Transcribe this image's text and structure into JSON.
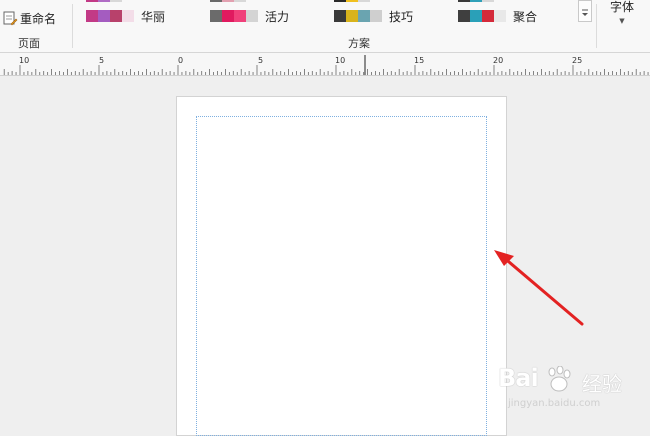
{
  "ribbon": {
    "page_group": {
      "rename_label": "重命名",
      "group_label": "页面"
    },
    "schemes_group": {
      "group_label": "方案",
      "top_row_swatches": [
        [
          "#c23a86",
          "#b06cc4",
          "#d8d8d8"
        ],
        [
          "#6a6a6a",
          "#e2a0b0",
          "#d8d8d8"
        ],
        [
          "#2a2a2a",
          "#f0c020",
          "#d8d8d8"
        ],
        [
          "#3a3a3a",
          "#30a0b8",
          "#d8d8d8"
        ]
      ],
      "schemes": [
        {
          "name": "华丽",
          "swatches": [
            "#c23a86",
            "#a45cc0",
            "#b8416b",
            "#f3dde8"
          ]
        },
        {
          "name": "活力",
          "swatches": [
            "#6b6b6b",
            "#e01a5f",
            "#f0407a",
            "#d4d4d4"
          ]
        },
        {
          "name": "技巧",
          "swatches": [
            "#3a3a3a",
            "#d8b31c",
            "#6aa4b0",
            "#cfcfcf"
          ]
        },
        {
          "name": "聚合",
          "swatches": [
            "#3f3f3f",
            "#2aa0b8",
            "#d42a3a",
            "#e8e8e8"
          ]
        }
      ]
    },
    "font_button": {
      "label": "字体"
    }
  },
  "ruler": {
    "labels": [
      "10",
      "5",
      "0",
      "5",
      "10",
      "15",
      "20",
      "25"
    ]
  },
  "watermark": {
    "logo": "Bai",
    "cn": "经验",
    "url": "jingyan.baidu.com"
  },
  "colors": {
    "arrow": "#e32222",
    "margin_guide": "#7fb0e0"
  }
}
